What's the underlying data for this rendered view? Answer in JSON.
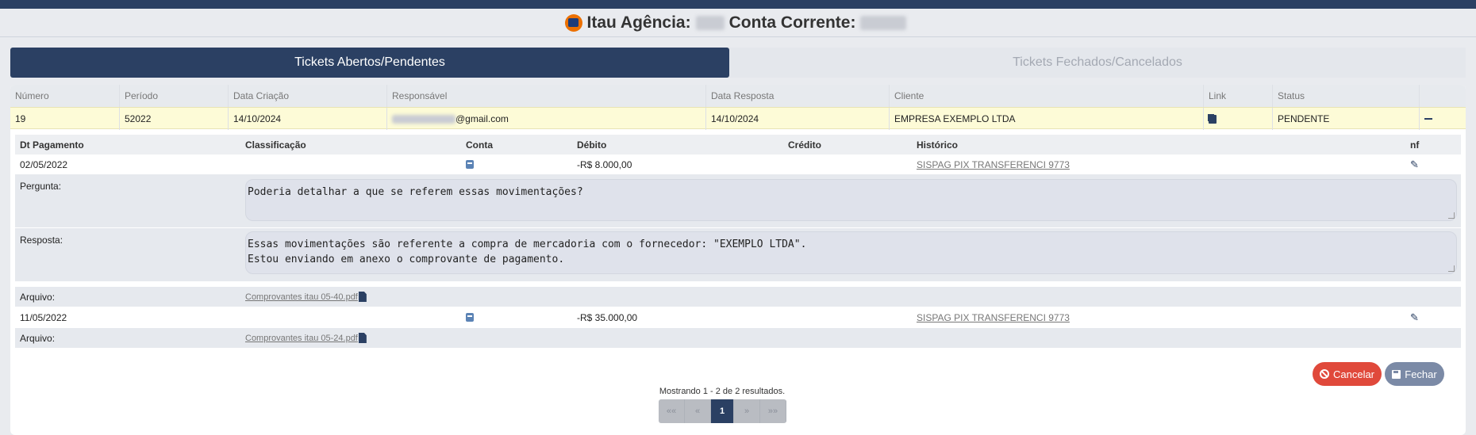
{
  "header": {
    "agencia_label": "Itau Agência:",
    "conta_label": "Conta Corrente:"
  },
  "tabs": [
    {
      "label": "Tickets Abertos/Pendentes",
      "active": true
    },
    {
      "label": "Tickets Fechados/Cancelados",
      "active": false
    }
  ],
  "table": {
    "columns": [
      "Número",
      "Período",
      "Data Criação",
      "Responsável",
      "Data Resposta",
      "Cliente",
      "Link",
      "Status"
    ],
    "row": {
      "numero": "19",
      "periodo": "52022",
      "data_criacao": "14/10/2024",
      "responsavel": "@gmail.com",
      "data_resposta": "14/10/2024",
      "cliente": "EMPRESA EXEMPLO LTDA",
      "status": "PENDENTE"
    }
  },
  "details": {
    "columns": [
      "Dt Pagamento",
      "Classificação",
      "Conta",
      "Débito",
      "Crédito",
      "Histórico",
      "nf"
    ],
    "entries": [
      {
        "dt_pagamento": "02/05/2022",
        "debito": "-R$ 8.000,00",
        "historico": "SISPAG PIX TRANSFERENCI 9773",
        "pergunta_label": "Pergunta:",
        "pergunta": "Poderia detalhar a que se referem essas movimentações?",
        "resposta_label": "Resposta:",
        "resposta": "Essas movimentações são referente a compra de mercadoria com o fornecedor: \"EXEMPLO LTDA\".\nEstou enviando em anexo o comprovante de pagamento.",
        "arquivo_label": "Arquivo:",
        "arquivo": "Comprovantes itau 05-40.pdf"
      },
      {
        "dt_pagamento": "11/05/2022",
        "debito": "-R$ 35.000,00",
        "historico": "SISPAG PIX TRANSFERENCI 9773",
        "arquivo_label": "Arquivo:",
        "arquivo": "Comprovantes itau 05-24.pdf"
      }
    ]
  },
  "actions": {
    "cancel": "Cancelar",
    "close": "Fechar"
  },
  "pagination": {
    "summary": "Mostrando 1 - 2 de 2 resultados.",
    "first": "««",
    "prev": "«",
    "current": "1",
    "next": "»",
    "last": "»»"
  },
  "colors": {
    "primary": "#2b4063",
    "danger": "#e0493b",
    "highlight_row": "#fdfbd7",
    "brand_orange": "#ec7000"
  },
  "icons": [
    "itau-logo-icon",
    "copy-icon",
    "collapse-icon",
    "account-book-icon",
    "edit-icon",
    "file-icon",
    "cancel-icon",
    "save-icon"
  ]
}
